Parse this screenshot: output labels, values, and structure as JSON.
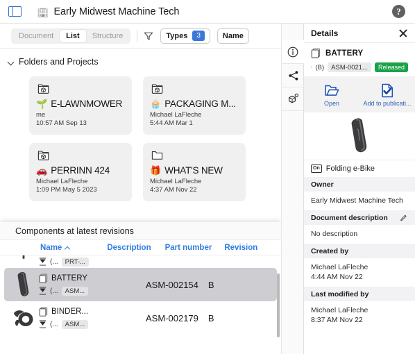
{
  "appbar": {
    "sidebar_toggle_name": "sidebar-toggle-icon",
    "company_icon": "🏢",
    "title": "Early Midwest Machine Tech",
    "help_label": "?"
  },
  "toolbar": {
    "segments": [
      {
        "label": "Document",
        "active": false
      },
      {
        "label": "List",
        "active": true
      },
      {
        "label": "Structure",
        "active": false
      }
    ],
    "filter_icon": "funnel-icon",
    "types_label": "Types",
    "types_count": "3",
    "name_label": "Name"
  },
  "main": {
    "section_title": "Folders and Projects",
    "cards": [
      {
        "emoji": "🌱",
        "title": "E-LAWNMOWER",
        "owner": "me",
        "timestamp": "10:57 AM Sep 13",
        "icon": "folder-3d-icon"
      },
      {
        "emoji": "🧁",
        "title": "PACKAGING M...",
        "owner": "Michael LaFleche",
        "timestamp": "5:44 AM Mar 1",
        "icon": "folder-3d-icon"
      },
      {
        "emoji": "🚗",
        "title": "PERRINN 424",
        "owner": "Michael LaFleche",
        "timestamp": "1:09 PM May 5 2023",
        "icon": "folder-3d-icon"
      },
      {
        "emoji": "🎁",
        "title": "WHAT'S NEW",
        "owner": "Michael LaFleche",
        "timestamp": "4:37 AM Nov 22",
        "icon": "folder-plain-icon"
      }
    ]
  },
  "components": {
    "title": "Components at latest revisions",
    "columns": [
      {
        "label": "Name",
        "sorted": true,
        "sort_dir": "asc"
      },
      {
        "label": "Description",
        "sorted": false
      },
      {
        "label": "Part number",
        "sorted": false
      },
      {
        "label": "Revision",
        "sorted": false
      }
    ],
    "rows": [
      {
        "name": "",
        "revision_prefix": "(...",
        "chip": "PRT-...",
        "description": "",
        "part_number": "",
        "revision": "",
        "selected": false,
        "partial": true
      },
      {
        "name": "BATTERY",
        "revision_prefix": "(...",
        "chip": "ASM...",
        "description": "",
        "part_number": "ASM-002154",
        "revision": "B",
        "selected": true,
        "partial": false
      },
      {
        "name": "BINDER...",
        "revision_prefix": "(...",
        "chip": "ASM...",
        "description": "",
        "part_number": "ASM-002179",
        "revision": "B",
        "selected": false,
        "partial": false
      }
    ]
  },
  "rail": {
    "items": [
      {
        "name": "info-icon",
        "active": true
      },
      {
        "name": "share-icon",
        "active": false
      },
      {
        "name": "cube-badge-icon",
        "active": false
      }
    ]
  },
  "details": {
    "title": "Details",
    "close_label": "close-icon",
    "item": {
      "name": "BATTERY",
      "revision": "(B)",
      "part_number": "ASM-0021...",
      "status": "Released"
    },
    "actions": [
      {
        "icon": "open-folder-icon",
        "label": "Open"
      },
      {
        "icon": "add-to-publication-icon",
        "label": "Add to publicati..."
      }
    ],
    "parent": {
      "badge": "On",
      "label": "Folding e-Bike"
    },
    "properties": [
      {
        "label": "Owner",
        "value": "Early Midwest Machine Tech",
        "editable": false
      },
      {
        "label": "Document description",
        "value": "No description",
        "editable": true
      },
      {
        "label": "Created by",
        "value": "Michael LaFleche\n4:44 AM Nov 22",
        "editable": false
      },
      {
        "label": "Last modified by",
        "value": "Michael LaFleche\n8:37 AM Nov 22",
        "editable": false
      }
    ]
  },
  "colors": {
    "accent_blue": "#2f7de1",
    "badge_blue": "#3b77d8",
    "status_green": "#1aa24a",
    "selection_gray": "#cdcdd2",
    "panel_gray": "#f0f0f0"
  }
}
